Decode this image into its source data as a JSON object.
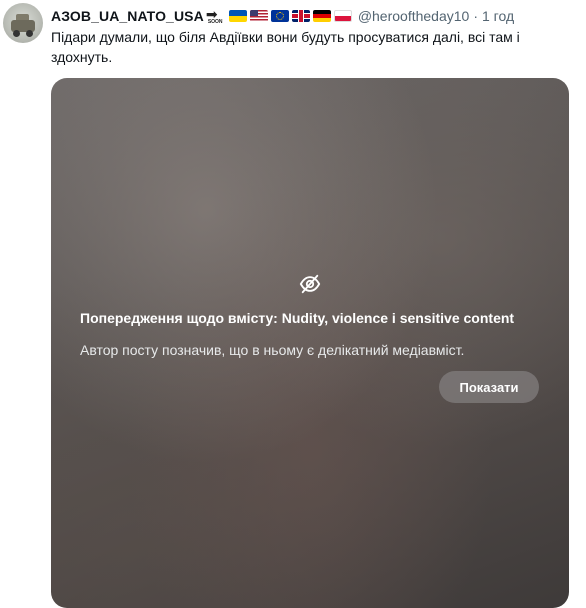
{
  "author": {
    "display_name": "АЗОВ_UA_NATO_USA",
    "soon_badge": "SOON",
    "flags": [
      "flag-ukraine",
      "flag-usa",
      "flag-eu",
      "flag-uk",
      "flag-germany",
      "flag-poland"
    ],
    "handle": "@herooftheday10",
    "separator": "·",
    "time": "1 год"
  },
  "tweet": {
    "text": "Підари думали, що біля Авдіївки вони будуть просуватися далі, всі там і здохнуть."
  },
  "media_warning": {
    "icon": "eye-off-icon",
    "title": "Попередження щодо вмісту: Nudity, violence і sensitive content",
    "description": "Автор посту позначив, що в ньому є делікатний медіавміст.",
    "show_button_label": "Показати"
  }
}
